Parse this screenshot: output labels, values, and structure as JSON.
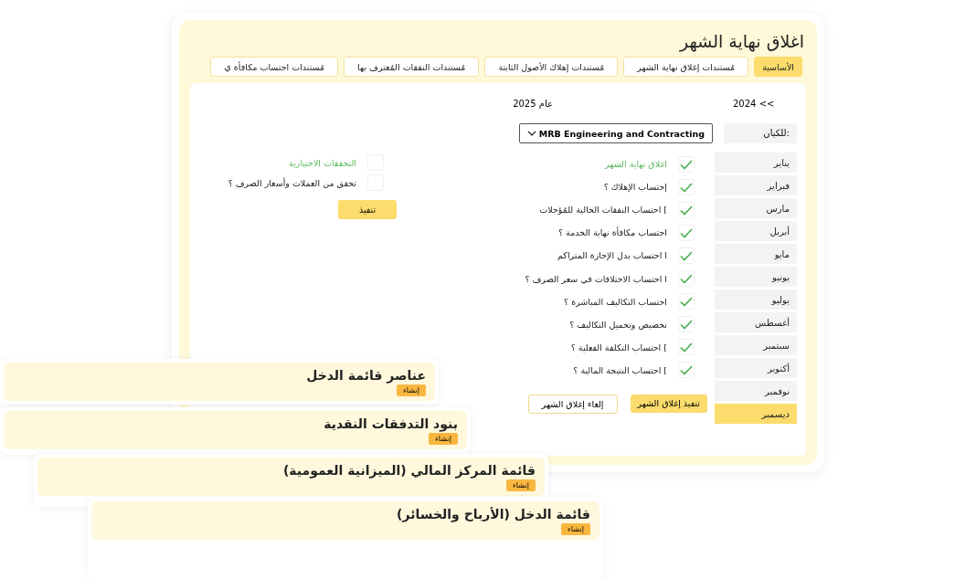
{
  "window": {
    "title": "اغلاق نهاية الشهر"
  },
  "tabs": [
    {
      "label": "الأساسية",
      "selected": true
    },
    {
      "label": "مُستندات إغلاق نهاية الشهر",
      "selected": false
    },
    {
      "label": "مُستندات إهلاك الأصول الثابتة",
      "selected": false
    },
    {
      "label": "مُستندات النفقات المُعترف بها",
      "selected": false
    },
    {
      "label": "مُستندات احتساب مكافأة ي",
      "selected": false
    }
  ],
  "year_nav": {
    "previous": "2024 <<",
    "current": "2025 عام"
  },
  "entity": {
    "label": ":للكيان",
    "value": "MRB Engineering and Contracting"
  },
  "months": [
    {
      "label": "يناير",
      "selected": false
    },
    {
      "label": "فبراير",
      "selected": false
    },
    {
      "label": "مارس",
      "selected": false
    },
    {
      "label": "أبريل",
      "selected": false
    },
    {
      "label": "مايو",
      "selected": false
    },
    {
      "label": "يونيو",
      "selected": false
    },
    {
      "label": "يوليو",
      "selected": false
    },
    {
      "label": "أغسطس",
      "selected": false
    },
    {
      "label": "سبتمبر",
      "selected": false
    },
    {
      "label": "أكتوبر",
      "selected": false
    },
    {
      "label": "نوفمبر",
      "selected": false
    },
    {
      "label": "ديسمبر",
      "selected": true
    }
  ],
  "checks": [
    {
      "label": "اغلاق نهاية الشهر",
      "kind": "heading",
      "checked": true
    },
    {
      "label": "إحتساب الإهلاك ؟",
      "kind": "item",
      "checked": true
    },
    {
      "label": "] احتساب النفقات الحالية للمُؤجلات",
      "kind": "item",
      "checked": true
    },
    {
      "label": "احتساب مكافأة نهاية الخدمة ؟",
      "kind": "item",
      "checked": true
    },
    {
      "label": "ا احتساب بدل الإجازة المتراكم",
      "kind": "item",
      "checked": true
    },
    {
      "label": "ا احتساب الاختلافات في سعر الصرف ؟",
      "kind": "item",
      "checked": true
    },
    {
      "label": "احتساب التكاليف المباشرة ؟",
      "kind": "item",
      "checked": true
    },
    {
      "label": "تخصيص وتحميل التكاليف ؟",
      "kind": "item",
      "checked": true
    },
    {
      "label": "] احتساب التكلفة الفعلية ؟",
      "kind": "item",
      "checked": true
    },
    {
      "label": "] احتساب النتيجة المالية ؟",
      "kind": "item",
      "checked": true
    }
  ],
  "optional_checks": [
    {
      "label": "التحققات الاختيارية",
      "kind": "heading",
      "checked": false
    },
    {
      "label": "تحقق من العملات وأسعار الصرف ؟",
      "kind": "item",
      "checked": false
    }
  ],
  "run_button": "تنفيذ",
  "close_buttons": {
    "run": "تنفيذ إغلاق الشهر",
    "cancel": "إلغاء إغلاق الشهر"
  },
  "report_cards": [
    {
      "title": "عناصر قائمة الدخل",
      "button": "إنشاء"
    },
    {
      "title": "بنود التدفقات النقدية",
      "button": "إنشاء"
    },
    {
      "title": "قائمة المركز المالي (الميزانية العمومية)",
      "button": "إنشاء"
    },
    {
      "title": "قائمة الدخل (الأرباح والخسائر)",
      "button": "إنشاء"
    }
  ]
}
